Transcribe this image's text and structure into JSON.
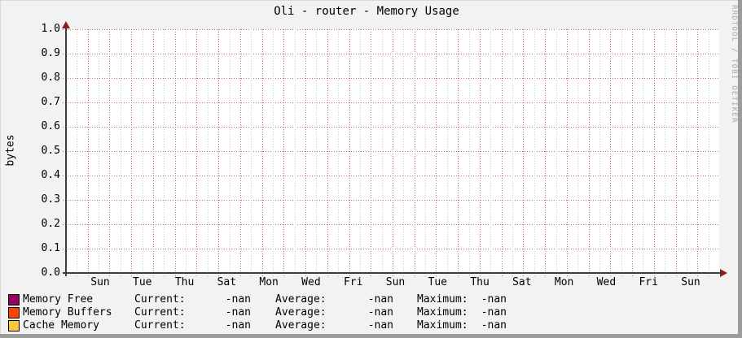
{
  "title": "Oli - router - Memory Usage",
  "watermark": "RRDTOOL / TOBI OETIKER",
  "chart_data": {
    "type": "area",
    "title": "Oli - router - Memory Usage",
    "ylabel": "bytes",
    "xlabel": "",
    "ylim": [
      0.0,
      1.0
    ],
    "y_tick_labels": [
      "1.0",
      "0.9",
      "0.8",
      "0.7",
      "0.6",
      "0.5",
      "0.4",
      "0.3",
      "0.2",
      "0.1",
      "0.0"
    ],
    "x_tick_labels": [
      "Sun",
      "Tue",
      "Thu",
      "Sat",
      "Mon",
      "Wed",
      "Fri",
      "Sun",
      "Tue",
      "Thu",
      "Sat",
      "Mon",
      "Wed",
      "Fri",
      "Sun"
    ],
    "grid": true,
    "legend_position": "bottom",
    "series": [
      {
        "name": "Memory Free",
        "color": "#960064",
        "values": [],
        "current": "-nan",
        "average": "-nan",
        "maximum": "-nan"
      },
      {
        "name": "Memory Buffers",
        "color": "#FB4200",
        "values": [],
        "current": "-nan",
        "average": "-nan",
        "maximum": "-nan"
      },
      {
        "name": "Cache Memory",
        "color": "#FDC73C",
        "values": [],
        "current": "-nan",
        "average": "-nan",
        "maximum": "-nan"
      }
    ]
  },
  "legend": {
    "stat_labels": {
      "current": "Current:",
      "average": "Average:",
      "maximum": "Maximum:"
    },
    "rows": [
      {
        "color": "#960064",
        "label": "Memory Free",
        "current": "-nan",
        "average": "-nan",
        "maximum": "-nan"
      },
      {
        "color": "#FB4200",
        "label": "Memory Buffers",
        "current": "-nan",
        "average": "-nan",
        "maximum": "-nan"
      },
      {
        "color": "#FDC73C",
        "label": "Cache Memory",
        "current": "-nan",
        "average": "-nan",
        "maximum": "-nan"
      }
    ]
  }
}
